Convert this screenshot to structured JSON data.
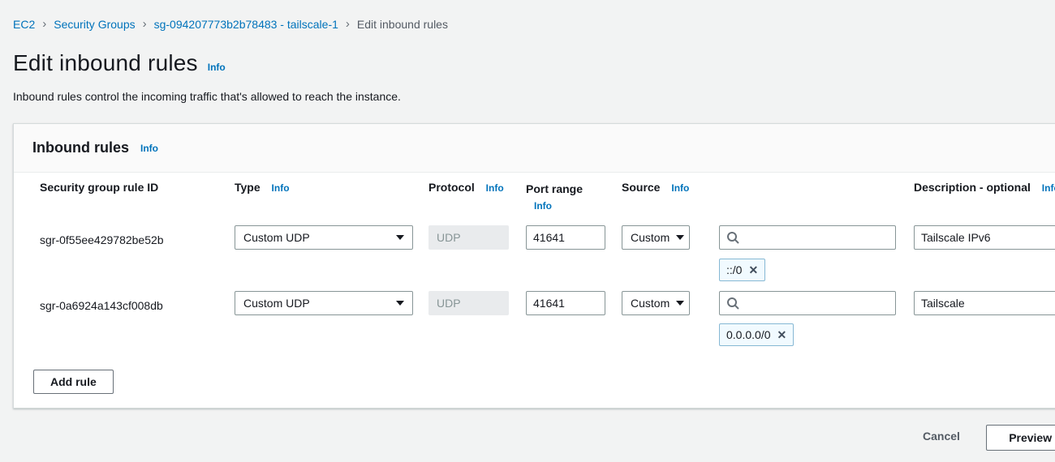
{
  "breadcrumb": {
    "separator": "›",
    "items": [
      {
        "label": "EC2"
      },
      {
        "label": "Security Groups"
      },
      {
        "label": "sg-094207773b2b78483 - tailscale-1"
      },
      {
        "label": "Edit inbound rules"
      }
    ]
  },
  "page": {
    "title": "Edit inbound rules",
    "info_label": "Info",
    "description": "Inbound rules control the incoming traffic that's allowed to reach the instance."
  },
  "panel": {
    "title": "Inbound rules",
    "info_label": "Info"
  },
  "table": {
    "headers": {
      "rule_id": "Security group rule ID",
      "type": "Type",
      "protocol": "Protocol",
      "port_range": "Port range",
      "source": "Source",
      "description": "Description - optional",
      "info_label": "Info"
    }
  },
  "rules": [
    {
      "id": "sgr-0f55ee429782be52b",
      "type": "Custom UDP",
      "protocol": "UDP",
      "port_range": "41641",
      "source_type": "Custom",
      "source_token": "::/0",
      "description": "Tailscale IPv6"
    },
    {
      "id": "sgr-0a6924a143cf008db",
      "type": "Custom UDP",
      "protocol": "UDP",
      "port_range": "41641",
      "source_type": "Custom",
      "source_token": "0.0.0.0/0",
      "description": "Tailscale"
    }
  ],
  "actions": {
    "add_rule": "Add rule",
    "cancel": "Cancel",
    "preview": "Preview changes"
  },
  "colors": {
    "link_blue": "#0073bb",
    "text": "#16191f",
    "page_bg": "#f2f3f3",
    "token_bg": "#f1faff",
    "token_border": "#86b8d4"
  }
}
